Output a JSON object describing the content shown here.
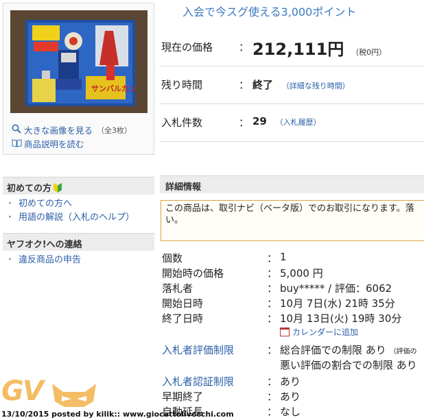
{
  "image_panel": {
    "enlarge_label": "大きな画像を見る",
    "image_count": "（全3枚）",
    "description_label": "商品説明を読む"
  },
  "points_banner": "入会で今スグ使える3,000ポイント",
  "price_info": {
    "separator": "：",
    "current_price_label": "現在の価格",
    "current_price_value": "212,111円",
    "tax_note": "（税0円）",
    "remaining_label": "残り時間",
    "remaining_value": "終了",
    "remaining_link": "（詳細な残り時間）",
    "bids_label": "入札件数",
    "bids_value": "29",
    "bids_link": "（入札履歴）"
  },
  "sidebar": {
    "beginners_title": "初めての方",
    "beginners_items": [
      "初めての方へ",
      "用語の解説（入札のヘルプ）"
    ],
    "contact_title": "ヤフオク!への連絡",
    "contact_items": [
      "違反商品の申告"
    ],
    "bullet": "・"
  },
  "details": {
    "title": "詳細情報",
    "notice": "この商品は、取引ナビ（ベータ版）でのお取引になります。落",
    "notice_line2": "い。",
    "rows": {
      "quantity": {
        "label": "個数",
        "value": "1"
      },
      "start_price": {
        "label": "開始時の価格",
        "value": "5,000 円"
      },
      "winner": {
        "label": "落札者",
        "value": "buy***** / 評価：6062"
      },
      "start_time": {
        "label": "開始日時",
        "value": "10月 7日(水) 21時 35分"
      },
      "end_time": {
        "label": "終了日時",
        "value": "10月 13日(火) 19時 30分"
      },
      "calendar_link": "カレンダーに追加",
      "rating_limit": {
        "label": "入札者評価制限",
        "value": "総合評価での制限 あり",
        "value_note": "（評価の",
        "value2": "悪い評価の割合での制限 あり"
      },
      "auth_limit": {
        "label": "入札者認証制限",
        "value": "あり"
      },
      "early_end": {
        "label": "早期終了",
        "value": "あり"
      },
      "auto_extend": {
        "label": "自動延長",
        "value": "なし"
      }
    }
  },
  "watermark": {
    "logo": "GV",
    "caption": "13/10/2015 posted by kilik:: www.giocattolivecchi.com"
  },
  "colors": {
    "link": "#2a5ea8",
    "banner": "#3c79c3",
    "notice_border": "#d9a441",
    "watermark": "#f2b24a"
  }
}
